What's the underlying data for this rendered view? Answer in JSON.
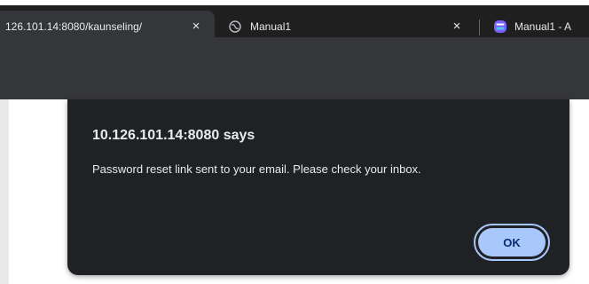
{
  "tabs": [
    {
      "title": "126.101.14:8080/kaunseling/",
      "close": "×",
      "active": true
    },
    {
      "title": "Manual1",
      "close": "×",
      "icon": "globe-icon",
      "active": false
    },
    {
      "title": "Manual1 - A",
      "icon": "app-icon",
      "active": false
    }
  ],
  "dialog": {
    "title": "10.126.101.14:8080 says",
    "message": "Password reset link sent to your email. Please check your inbox.",
    "ok_label": "OK"
  },
  "colors": {
    "dialog_bg": "#202124",
    "button_accent": "#a8c7fa",
    "button_text": "#062e6f",
    "page_bg": "#ffffff"
  }
}
